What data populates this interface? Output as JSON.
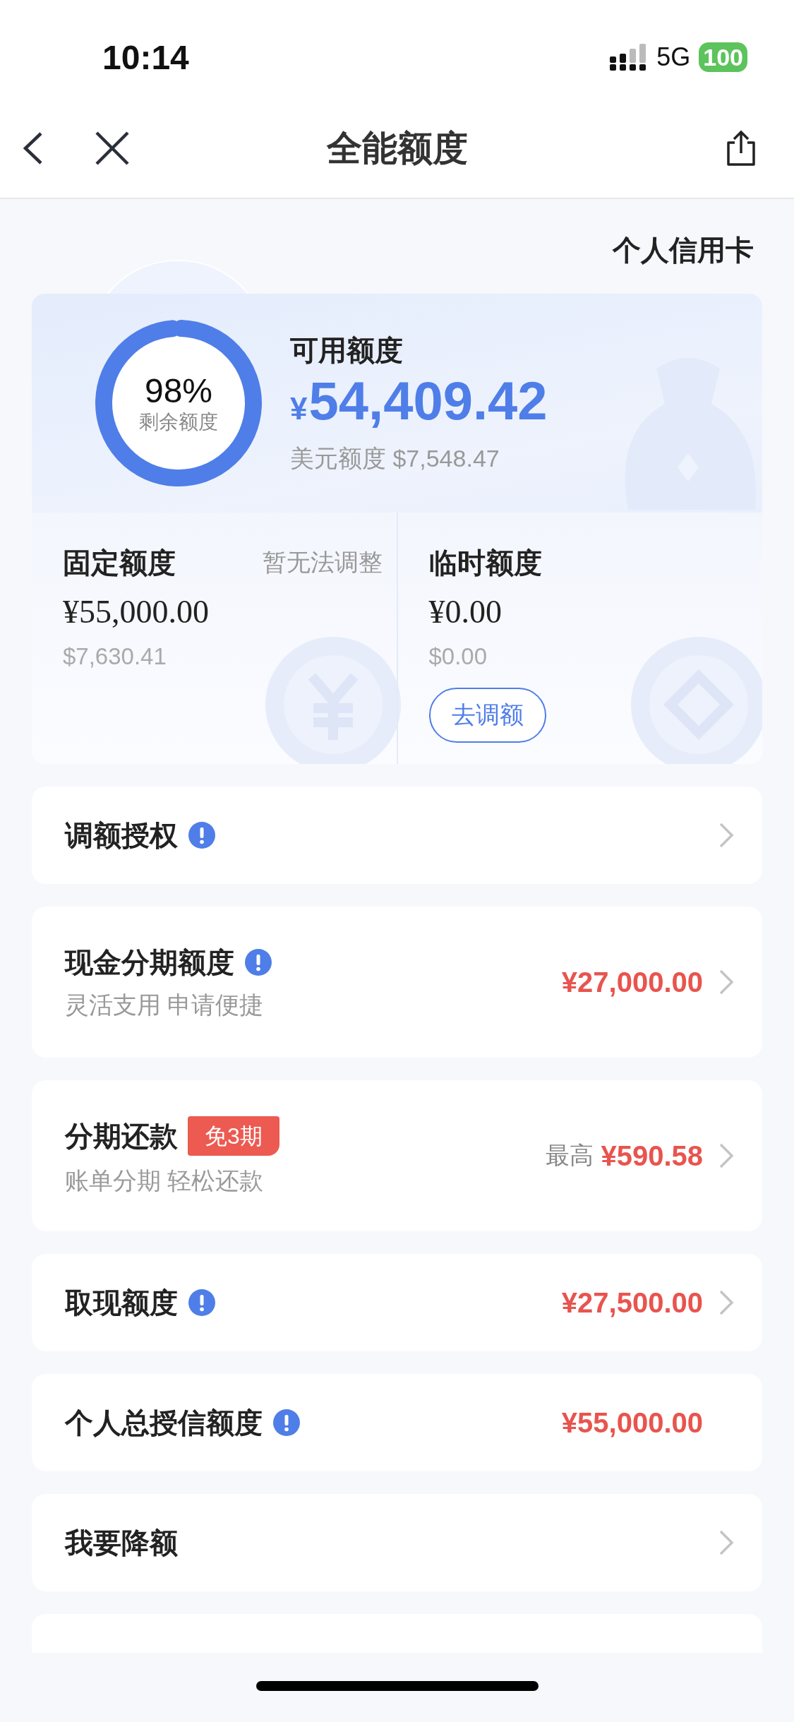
{
  "status_bar": {
    "time": "10:14",
    "network": "5G",
    "battery": "100"
  },
  "nav": {
    "title": "全能额度"
  },
  "card_type": "个人信用卡",
  "available": {
    "ring_label": "98%",
    "ring_caption": "剩余额度",
    "level": 0.98,
    "title": "可用额度",
    "currency": "¥",
    "amount": "54,409.42",
    "usd": "美元额度 $7,548.47"
  },
  "limits": [
    {
      "title": "固定额度",
      "note": "暂无法调整",
      "amount": "¥55,000.00",
      "usd": "$7,630.41"
    },
    {
      "title": "临时额度",
      "amount": "¥0.00",
      "usd": "$0.00",
      "button": "去调额"
    }
  ],
  "rows": [
    {
      "title": "调额授权",
      "info": true,
      "chevron": true
    },
    {
      "title": "现金分期额度",
      "info": true,
      "subtitle": "灵活支用 申请便捷",
      "amount": "¥27,000.00",
      "chevron": true
    },
    {
      "title": "分期还款",
      "badge": "免3期",
      "subtitle": "账单分期 轻松还款",
      "prefix": "最高",
      "amount": "¥590.58",
      "chevron": true
    },
    {
      "title": "取现额度",
      "info": true,
      "amount": "¥27,500.00",
      "chevron": true
    },
    {
      "title": "个人总授信额度",
      "info": true,
      "amount": "¥55,000.00",
      "chevron": false
    },
    {
      "title": "我要降额",
      "chevron": true
    }
  ]
}
